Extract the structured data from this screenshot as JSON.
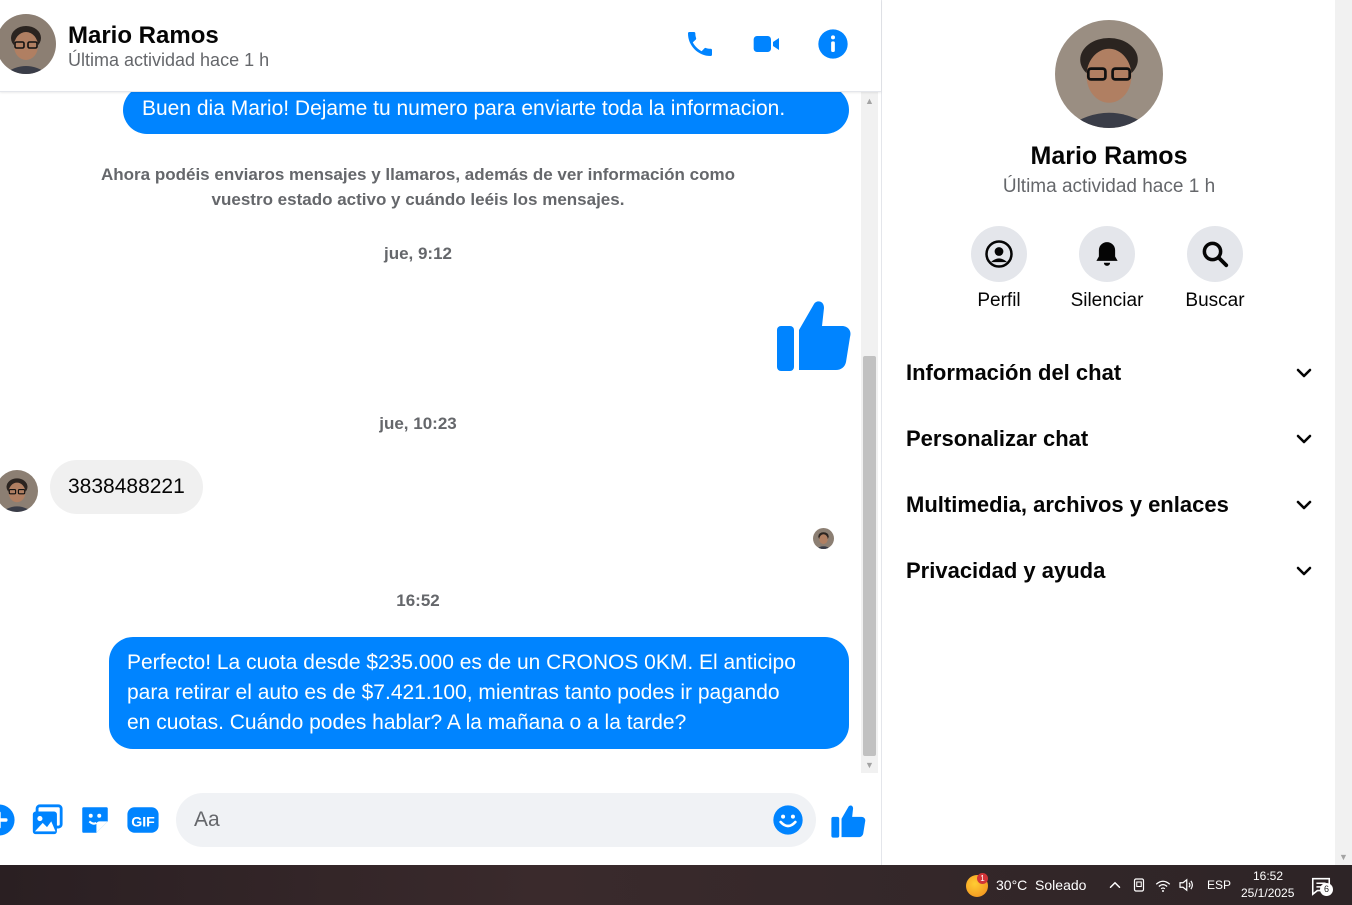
{
  "contact": {
    "name": "Mario Ramos",
    "status": "Última actividad hace 1 h"
  },
  "messages": {
    "out_1": "Buen dia Mario! Dejame tu numero para enviarte toda la informacion.",
    "system_note_line1": "Ahora podéis enviaros mensajes y llamaros, además de ver información como",
    "system_note_line2": "vuestro estado activo y cuándo leéis los mensajes.",
    "time_1": "jue, 9:12",
    "time_2": "jue, 10:23",
    "in_1": "3838488221",
    "time_3": "16:52",
    "out_2_line1": "Perfecto! La cuota desde $235.000 es de un CRONOS 0KM. El anticipo",
    "out_2_line2": "para retirar el auto es de $7.421.100, mientras tanto podes ir pagando",
    "out_2_line3": "en cuotas. Cuándo podes hablar? A la mañana o a la tarde?"
  },
  "composer": {
    "placeholder": "Aa"
  },
  "info": {
    "actions": [
      {
        "label": "Perfil",
        "icon": "profile-icon"
      },
      {
        "label": "Silenciar",
        "icon": "bell-icon"
      },
      {
        "label": "Buscar",
        "icon": "search-icon"
      }
    ],
    "sections": [
      {
        "label": "Información del chat"
      },
      {
        "label": "Personalizar chat"
      },
      {
        "label": "Multimedia, archivos y enlaces"
      },
      {
        "label": "Privacidad y ayuda"
      }
    ]
  },
  "taskbar": {
    "weather": "30°C  Soleado",
    "weather_badge": "1",
    "lang": "ESP",
    "time": "16:52",
    "date": "25/1/2025",
    "notif_count": "6"
  },
  "colors": {
    "accent": "#0084ff",
    "bubble_in": "#f0f0f0",
    "secondary_text": "#65676b"
  }
}
